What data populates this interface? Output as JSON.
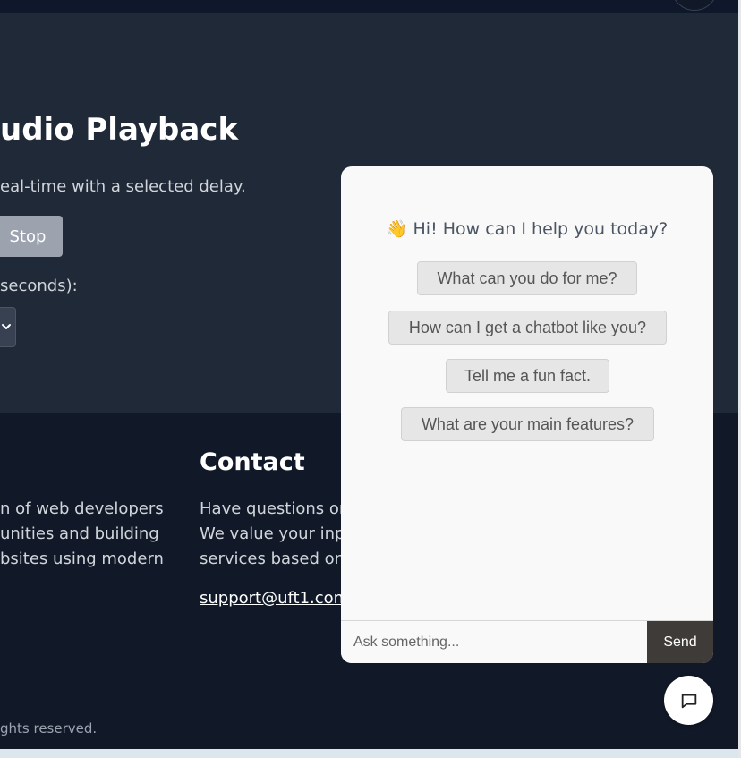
{
  "hero": {
    "title": "udio Playback",
    "description": "eal-time with a selected delay.",
    "stop_label": "Stop",
    "delay_label": "seconds):"
  },
  "footer": {
    "about_lines": [
      "n of web developers",
      "unities and building",
      "bsites using modern"
    ],
    "contact_heading": "Contact",
    "contact_lines": [
      "Have questions or",
      "We value your inp",
      "services based on"
    ],
    "email": "support@uft1.com",
    "copyright": "ghts reserved."
  },
  "chat": {
    "greeting_emoji": "👋",
    "greeting": "Hi! How can I help you today?",
    "suggestions": [
      "What can you do for me?",
      "How can I get a chatbot like you?",
      "Tell me a fun fact.",
      "What are your main features?"
    ],
    "input_placeholder": "Ask something...",
    "send_label": "Send",
    "toggle_icon": "chat-bubble-icon"
  },
  "colors": {
    "page_bg": "#111827",
    "hero_bg": "#1f2937",
    "chat_bg": "#f9f9f9",
    "send_bg": "#3f3b38"
  }
}
